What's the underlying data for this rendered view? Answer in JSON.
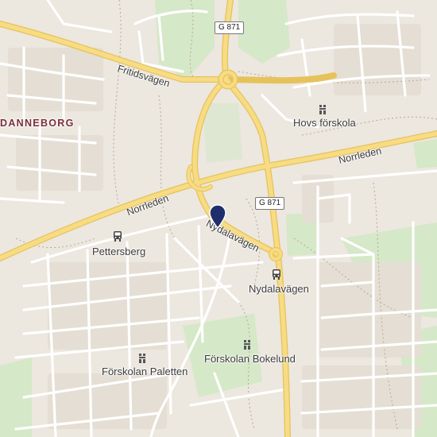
{
  "map": {
    "places": {
      "danneborg": "DANNEBORG",
      "pettersberg": "Pettersberg",
      "nydalavagen_stop": "Nydalavägen",
      "hovs_forskola": "Hovs förskola",
      "forskolan_paletten": "Förskolan Paletten",
      "forskolan_bokelund": "Förskolan Bokelund"
    },
    "roads": {
      "fritidsvagen": "Fritidsvägen",
      "norrleden_east": "Norrleden",
      "norrleden_west": "Norrleden",
      "nydalavagen_road": "Nydalavägen"
    },
    "shields": {
      "north": "G 871",
      "south": "G 871"
    },
    "colors": {
      "background": "#ece7df",
      "major_road": "#f7dc84",
      "major_road_casing": "#e6c25a",
      "minor_road": "#ffffff",
      "green": "#d5e8c8",
      "marker": "#1f2f6b",
      "area_label": "#7a2e3a"
    },
    "icons": [
      "location-marker-icon",
      "bus-stop-icon",
      "school-icon"
    ]
  }
}
